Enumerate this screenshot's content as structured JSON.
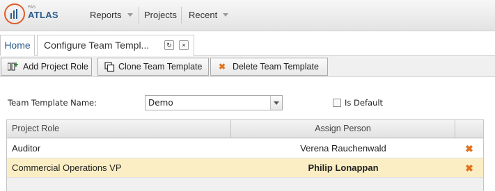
{
  "header": {
    "logo_small": "PAS",
    "logo_text": "ATLAS",
    "nav": [
      {
        "label": "Reports",
        "has_dropdown": true
      },
      {
        "label": "Projects",
        "has_dropdown": false
      },
      {
        "label": "Recent",
        "has_dropdown": true
      }
    ]
  },
  "tabs": {
    "home_label": "Home",
    "active_label": "Configure Team Templ...",
    "refresh_icon": "↻",
    "close_icon": "×"
  },
  "toolbar": {
    "add_label": "Add Project Role",
    "clone_label": "Clone Team Template",
    "delete_label": "Delete Team Template",
    "delete_icon_color": "#e0731f"
  },
  "form": {
    "template_name_label": "Team Template Name:",
    "template_name_value": "Demo",
    "is_default_label": "Is Default",
    "is_default_checked": false
  },
  "grid": {
    "columns": [
      "Project Role",
      "Assign Person"
    ],
    "rows": [
      {
        "role": "Auditor",
        "person": "Verena Rauchenwald",
        "selected": false
      },
      {
        "role": "Commercial Operations VP",
        "person": "Philip Lonappan",
        "selected": true
      }
    ],
    "delete_glyph": "✖",
    "selected_row_color": "#fbeec4"
  },
  "colors": {
    "brand_blue": "#2c5c8a",
    "brand_orange": "#e05c2a",
    "link_blue": "#2a5a8c"
  }
}
